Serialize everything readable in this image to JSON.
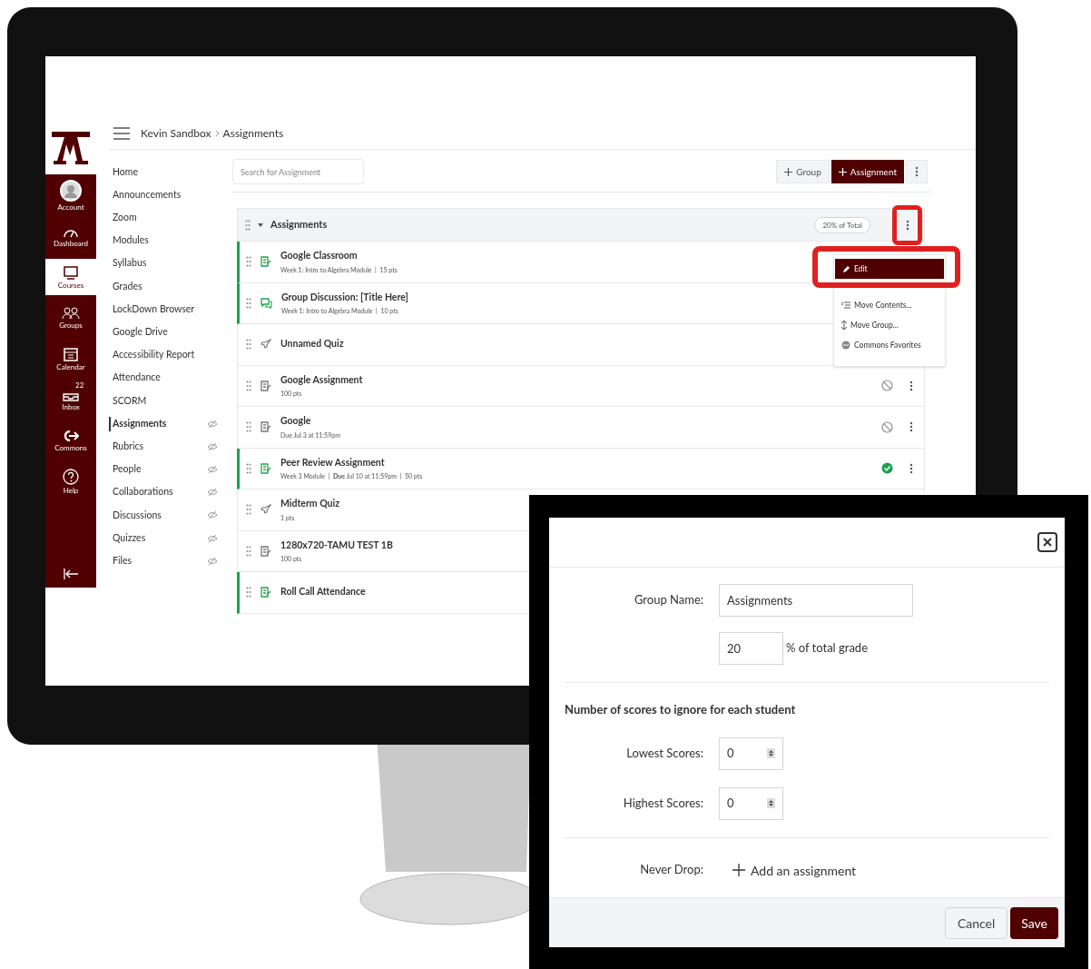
{
  "global_nav": [
    {
      "label": "Account",
      "selected": false
    },
    {
      "label": "Dashboard",
      "selected": false
    },
    {
      "label": "Courses",
      "selected": true
    },
    {
      "label": "Groups",
      "selected": false
    },
    {
      "label": "Calendar",
      "selected": false
    },
    {
      "label": "Inbox",
      "selected": false,
      "badge": "22"
    },
    {
      "label": "Commons",
      "selected": false
    },
    {
      "label": "Help",
      "selected": false
    }
  ],
  "breadcrumb": [
    "Kevin Sandbox",
    "Assignments"
  ],
  "course_nav": [
    {
      "label": "Home",
      "selected": false,
      "hidden": false
    },
    {
      "label": "Announcements",
      "selected": false,
      "hidden": false
    },
    {
      "label": "Zoom",
      "selected": false,
      "hidden": false
    },
    {
      "label": "Modules",
      "selected": false,
      "hidden": false
    },
    {
      "label": "Syllabus",
      "selected": false,
      "hidden": false
    },
    {
      "label": "Grades",
      "selected": false,
      "hidden": false
    },
    {
      "label": "LockDown Browser",
      "selected": false,
      "hidden": false
    },
    {
      "label": "Google Drive",
      "selected": false,
      "hidden": false
    },
    {
      "label": "Accessibility Report",
      "selected": false,
      "hidden": false
    },
    {
      "label": "Attendance",
      "selected": false,
      "hidden": false
    },
    {
      "label": "SCORM",
      "selected": false,
      "hidden": false
    },
    {
      "label": "Assignments",
      "selected": true,
      "hidden": true
    },
    {
      "label": "Rubrics",
      "selected": false,
      "hidden": true
    },
    {
      "label": "People",
      "selected": false,
      "hidden": true
    },
    {
      "label": "Collaborations",
      "selected": false,
      "hidden": true
    },
    {
      "label": "Discussions",
      "selected": false,
      "hidden": true
    },
    {
      "label": "Quizzes",
      "selected": false,
      "hidden": true
    },
    {
      "label": "Files",
      "selected": false,
      "hidden": true
    }
  ],
  "search": {
    "placeholder": "Search for Assignment"
  },
  "toolbar_buttons": [
    "Group",
    "Assignment"
  ],
  "group": {
    "name": "Assignments",
    "weight": "20% of Total"
  },
  "assignments": [
    {
      "kind": "assignment",
      "title": "Google Classroom",
      "details": "Week 1: Intro to Algebra Module  |  15 pts",
      "published": true
    },
    {
      "kind": "discussion",
      "title": "Group Discussion: [Title Here]",
      "details": "Week 1: Intro to Algebra Module  |  10 pts",
      "published": true
    },
    {
      "kind": "quiz",
      "title": "Unnamed Quiz",
      "published": false
    },
    {
      "kind": "assignment",
      "title": "Google Assignment",
      "details": "100 pts",
      "published": false,
      "publish_icon": true
    },
    {
      "kind": "assignment",
      "title": "Google",
      "details": "Due Jul 3 at 11:59pm",
      "published": false,
      "publish_icon": true
    },
    {
      "kind": "assignment",
      "title": "Peer Review Assignment",
      "details": "Week 3 Module  |  **Due** Jul 10 at 11:59pm  |  50 pts",
      "published": true,
      "publish_icon": true
    },
    {
      "kind": "quiz",
      "title": "Midterm Quiz",
      "details": "1 pts",
      "published": false
    },
    {
      "kind": "assignment",
      "title": "1280x720-TAMU TEST 1B",
      "details": "100 pts",
      "published": false
    },
    {
      "kind": "assignment",
      "title": "Roll Call Attendance",
      "published": true
    }
  ],
  "group_menu": [
    {
      "label": "Edit",
      "selected": true
    },
    {
      "label": "Move Contents...",
      "selected": false
    },
    {
      "label": "Move Group...",
      "selected": false
    },
    {
      "label": "Commons Favorites",
      "selected": false
    }
  ],
  "dialog": {
    "group_name_label": "Group Name:",
    "group_name": "Assignments",
    "weight": "20",
    "weight_suffix": "% of total grade",
    "drop_heading": "Number of scores to ignore for each student",
    "lowest_label": "Lowest Scores:",
    "lowest": "0",
    "highest_label": "Highest Scores:",
    "highest": "0",
    "never_drop_label": "Never Drop:",
    "add_link": "Add an assignment",
    "buttons": [
      "Cancel",
      "Save"
    ]
  }
}
